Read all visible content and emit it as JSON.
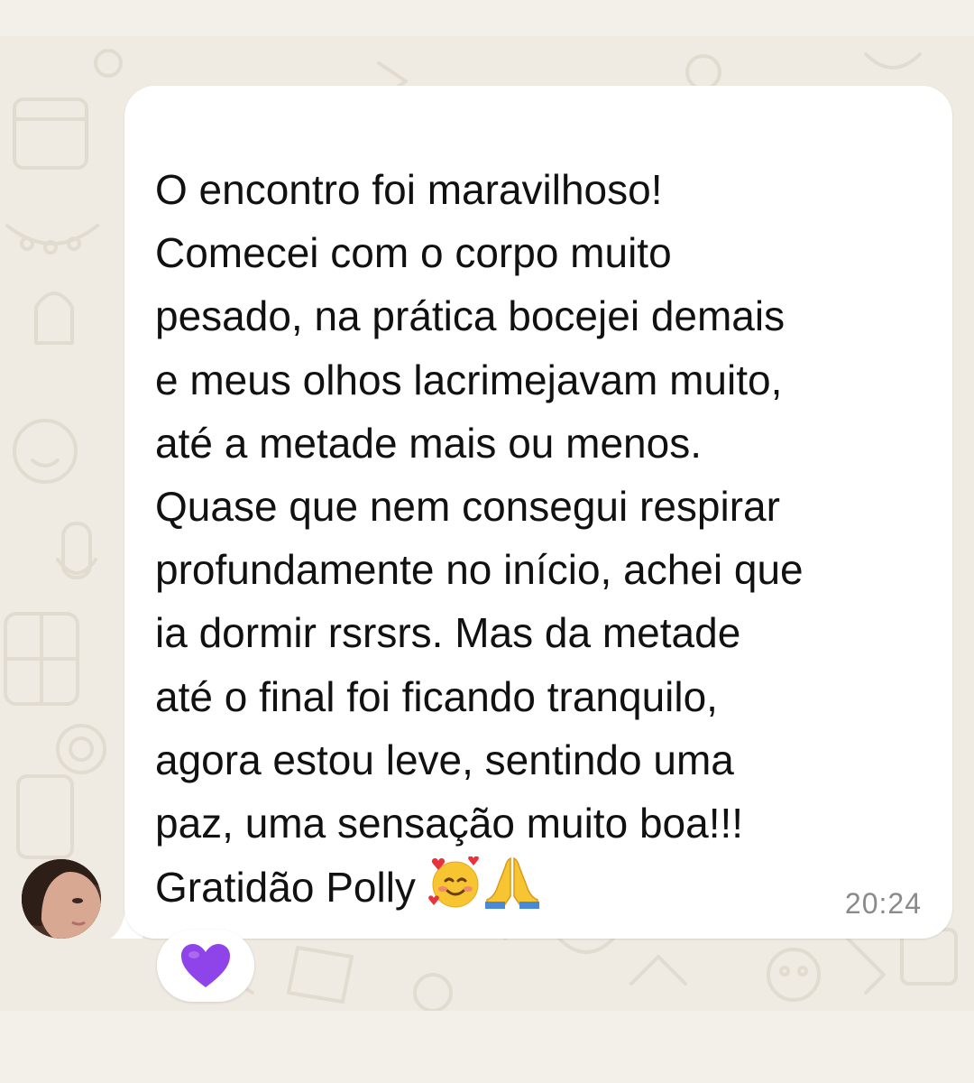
{
  "message": {
    "lines": [
      "O encontro foi maravilhoso!",
      "Comecei com o corpo muito",
      "pesado, na prática bocejei demais",
      "e meus olhos lacrimejavam muito,",
      "até a metade mais ou menos.",
      "Quase que nem consegui respirar",
      "profundamente no início, achei que",
      "ia dormir rsrsrs. Mas da metade",
      "até o final foi ficando tranquilo,",
      "agora estou leve, sentindo uma",
      "paz, uma sensação muito boa!!!"
    ],
    "last_line": "Gratidão Polly",
    "emojis": [
      "smiling-face-with-hearts-icon",
      "folded-hands-icon"
    ],
    "time": "20:24"
  },
  "reaction": {
    "icon": "purple-heart-icon",
    "color": "#8e44e8"
  },
  "colors": {
    "background": "#efeae2",
    "bubble": "#ffffff",
    "text": "#111111",
    "time": "#8a8a8a"
  }
}
